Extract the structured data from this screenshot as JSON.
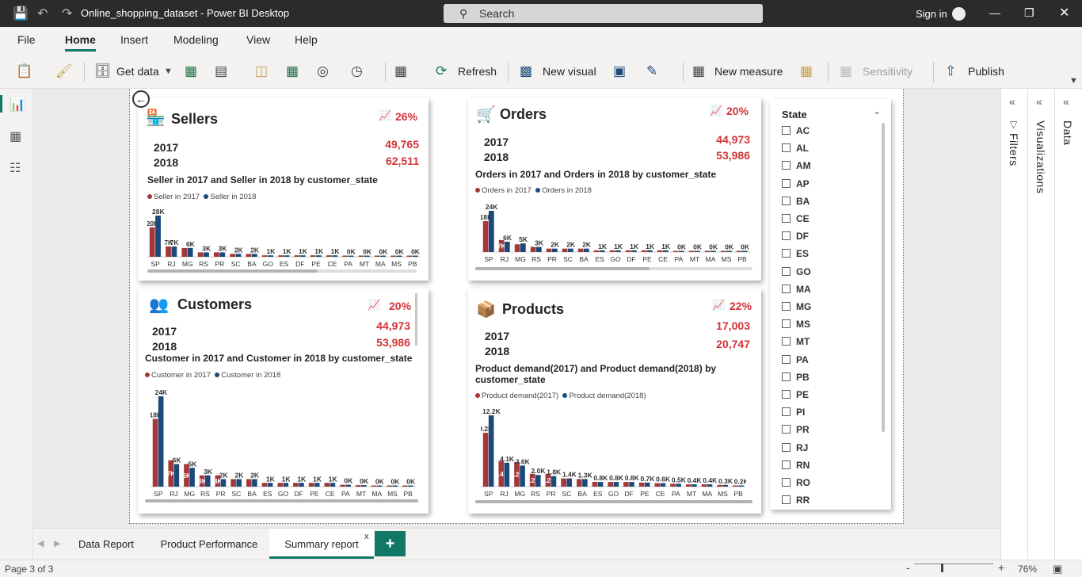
{
  "app": {
    "title": "Online_shopping_dataset - Power BI Desktop",
    "search_placeholder": "Search",
    "sign_in": "Sign in"
  },
  "menu": [
    "File",
    "Home",
    "Insert",
    "Modeling",
    "View",
    "Help"
  ],
  "ribbon": {
    "get_data": "Get data",
    "refresh": "Refresh",
    "new_visual": "New visual",
    "new_measure": "New measure",
    "sensitivity": "Sensitivity",
    "publish": "Publish"
  },
  "panes": {
    "filters": "Filters",
    "visualizations": "Visualizations",
    "data": "Data"
  },
  "colors": {
    "y2017": "#a4373a",
    "y2018": "#1b4a7a",
    "accent": "#117865",
    "pct": "#d13438"
  },
  "cards": {
    "sellers": {
      "title": "Sellers",
      "icon": "shop-icon",
      "pct": "26%",
      "y1": "2017",
      "y2": "2018",
      "v1": "49,765",
      "v2": "62,511",
      "chart_title": "Seller in 2017 and Seller in 2018 by customer_state",
      "legend1": "Seller in 2017",
      "legend2": "Seller in 2018"
    },
    "orders": {
      "title": "Orders",
      "icon": "cart-icon",
      "pct": "20%",
      "y1": "2017",
      "y2": "2018",
      "v1": "44,973",
      "v2": "53,986",
      "chart_title": "Orders in 2017 and Orders in 2018 by customer_state",
      "legend1": "Orders in 2017",
      "legend2": "Orders in 2018"
    },
    "customers": {
      "title": "Customers",
      "icon": "people-icon",
      "pct": "20%",
      "y1": "2017",
      "y2": "2018",
      "v1": "44,973",
      "v2": "53,986",
      "chart_title": "Customer in 2017 and Customer in 2018 by customer_state",
      "legend1": "Customer in 2017",
      "legend2": "Customer in 2018"
    },
    "products": {
      "title": "Products",
      "icon": "box-icon",
      "pct": "22%",
      "y1": "2017",
      "y2": "2018",
      "v1": "17,003",
      "v2": "20,747",
      "chart_title": "Product demand(2017) and Product demand(2018) by customer_state",
      "legend1": "Product demand(2017)",
      "legend2": "Product demand(2018)"
    }
  },
  "chart_data": [
    {
      "type": "bar",
      "id": "sellers",
      "categories": [
        "SP",
        "RJ",
        "MG",
        "RS",
        "PR",
        "SC",
        "BA",
        "GO",
        "ES",
        "DF",
        "PE",
        "CE",
        "PA",
        "MT",
        "MA",
        "MS",
        "PB"
      ],
      "series": [
        {
          "name": "Seller in 2017",
          "values": [
            20,
            7,
            6,
            3,
            3,
            2,
            2,
            1,
            1,
            1,
            1,
            1,
            0.5,
            0.4,
            0.3,
            0.3,
            0.3
          ],
          "labels": [
            "20K",
            "7K",
            "",
            "",
            "",
            "",
            "",
            "",
            "",
            "",
            "",
            "",
            "",
            "",
            "",
            "",
            ""
          ]
        },
        {
          "name": "Seller in 2018",
          "values": [
            28,
            7,
            6,
            3,
            3,
            2,
            2,
            1,
            1,
            1,
            1,
            1,
            0.5,
            0.4,
            0.3,
            0.3,
            0.3
          ],
          "labels": [
            "28K",
            "7K",
            "6K",
            "3K",
            "3K",
            "2K",
            "2K",
            "1K",
            "1K",
            "1K",
            "1K",
            "1K",
            "0K",
            "0K",
            "0K",
            "0K",
            "0K"
          ]
        }
      ]
    },
    {
      "type": "bar",
      "id": "orders",
      "categories": [
        "SP",
        "RJ",
        "MG",
        "RS",
        "PR",
        "SC",
        "BA",
        "ES",
        "GO",
        "DF",
        "PE",
        "CE",
        "PA",
        "MT",
        "MA",
        "MS",
        "PB"
      ],
      "series": [
        {
          "name": "Orders in 2017",
          "values": [
            18,
            7,
            4.5,
            3,
            2,
            2,
            2,
            1,
            1,
            1,
            1,
            1,
            0.5,
            0.4,
            0.3,
            0.3,
            0.3
          ],
          "labels": [
            "18K",
            "7K",
            "",
            "",
            "",
            "",
            "",
            "",
            "",
            "",
            "",
            "",
            "",
            "",
            "",
            "",
            ""
          ]
        },
        {
          "name": "Orders in 2018",
          "values": [
            24,
            6,
            5,
            3,
            2,
            2,
            2,
            1,
            1,
            1,
            1,
            1,
            0.5,
            0.4,
            0.3,
            0.3,
            0.3
          ],
          "labels": [
            "24K",
            "6K",
            "5K",
            "3K",
            "2K",
            "2K",
            "2K",
            "1K",
            "1K",
            "1K",
            "1K",
            "1K",
            "0K",
            "0K",
            "0K",
            "0K",
            "0K"
          ]
        }
      ]
    },
    {
      "type": "bar",
      "id": "customers",
      "categories": [
        "SP",
        "RJ",
        "MG",
        "RS",
        "PR",
        "SC",
        "BA",
        "ES",
        "GO",
        "DF",
        "PE",
        "CE",
        "PA",
        "MT",
        "MA",
        "MS",
        "PB"
      ],
      "series": [
        {
          "name": "Customer in 2017",
          "values": [
            18,
            7,
            6,
            3,
            3,
            2,
            2,
            1,
            1,
            1,
            1,
            1,
            0.5,
            0.4,
            0.3,
            0.3,
            0.3
          ],
          "labels": [
            "18K",
            "7K",
            "6K",
            "3K",
            "3K",
            "",
            "",
            "",
            "",
            "",
            "",
            "",
            "",
            "",
            "",
            "",
            ""
          ]
        },
        {
          "name": "Customer in 2018",
          "values": [
            24,
            6,
            5,
            3,
            2,
            2,
            2,
            1,
            1,
            1,
            1,
            1,
            0.5,
            0.4,
            0.3,
            0.3,
            0.3
          ],
          "labels": [
            "24K",
            "6K",
            "5K",
            "3K",
            "2K",
            "2K",
            "2K",
            "1K",
            "1K",
            "1K",
            "1K",
            "1K",
            "0K",
            "0K",
            "0K",
            "0K",
            "0K"
          ]
        }
      ]
    },
    {
      "type": "bar",
      "id": "products",
      "categories": [
        "SP",
        "RJ",
        "MG",
        "RS",
        "PR",
        "SC",
        "BA",
        "ES",
        "GO",
        "DF",
        "PE",
        "CE",
        "PA",
        "MT",
        "MA",
        "MS",
        "PB"
      ],
      "series": [
        {
          "name": "Product demand(2017)",
          "values": [
            9.2,
            4.4,
            4.2,
            2.2,
            2.2,
            1.4,
            1.3,
            0.8,
            0.8,
            0.8,
            0.7,
            0.6,
            0.5,
            0.4,
            0.4,
            0.3,
            0.2
          ],
          "labels": [
            "9.2K",
            "4.4K",
            "4.2K",
            "2.2K",
            "2.2K",
            "",
            "",
            "",
            "",
            "",
            "",
            "",
            "",
            "",
            "",
            "",
            ""
          ]
        },
        {
          "name": "Product demand(2018)",
          "values": [
            12.2,
            4.1,
            3.6,
            2.0,
            1.8,
            1.4,
            1.3,
            0.8,
            0.8,
            0.8,
            0.7,
            0.6,
            0.5,
            0.4,
            0.4,
            0.3,
            0.2
          ],
          "labels": [
            "12.2K",
            "4.1K",
            "3.6K",
            "2.0K",
            "1.8K",
            "1.4K",
            "1.3K",
            "0.8K",
            "0.8K",
            "0.8K",
            "0.7K",
            "0.6K",
            "0.5K",
            "0.4K",
            "0.4K",
            "0.3K",
            "0.2K"
          ]
        }
      ]
    }
  ],
  "slicer": {
    "title": "State",
    "items": [
      "AC",
      "AL",
      "AM",
      "AP",
      "BA",
      "CE",
      "DF",
      "ES",
      "GO",
      "MA",
      "MG",
      "MS",
      "MT",
      "PA",
      "PB",
      "PE",
      "PI",
      "PR",
      "RJ",
      "RN",
      "RO",
      "RR"
    ]
  },
  "tabs": [
    "Data Report",
    "Product Performance",
    "Summary report"
  ],
  "tab_close": "x",
  "add_tab": "+",
  "status": {
    "page": "Page 3 of 3",
    "zoom": "76%",
    "minus": "-",
    "plus": "+"
  }
}
